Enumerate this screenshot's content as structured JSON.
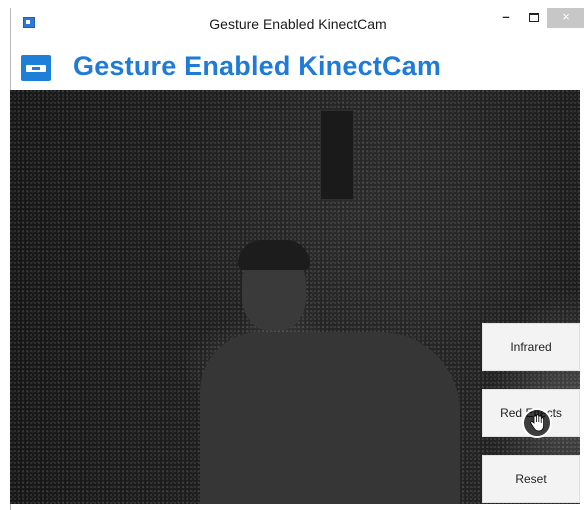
{
  "window": {
    "title": "Gesture Enabled KinectCam",
    "minimize_icon": "minimize-icon",
    "maximize_icon": "maximize-icon",
    "close_icon": "close-icon",
    "close_label": "×",
    "minimize_label": "–"
  },
  "header": {
    "logo_icon": "kinect-sensor-icon",
    "title": "Gesture Enabled KinectCam",
    "accent_color": "#1f7bd6"
  },
  "camera": {
    "feed": "infrared-camera-feed"
  },
  "buttons": {
    "infrared": "Infrared",
    "red_effects": "Red Effects",
    "reset": "Reset"
  },
  "cursor": {
    "icon": "hand-cursor-icon"
  }
}
